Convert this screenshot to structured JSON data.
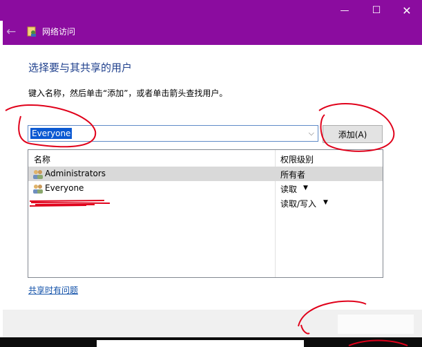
{
  "window": {
    "nav_title": "网络访问",
    "controls": {
      "minimize": "—",
      "maximize": "☐",
      "close": "✕"
    },
    "back_icon": "back-arrow-icon"
  },
  "page": {
    "heading": "选择要与其共享的用户",
    "instruction": "键入名称，然后单击“添加”，或者单击箭头查找用户。"
  },
  "user_input": {
    "value": "Everyone"
  },
  "add_button": {
    "label": "添加(A)"
  },
  "user_table": {
    "headers": [
      "名称",
      "权限级别"
    ],
    "rows": [
      {
        "name": "Administrators",
        "permission": "所有者",
        "selected": true,
        "has_dropdown": false
      },
      {
        "name": "Everyone",
        "permission": "读取",
        "selected": false,
        "has_dropdown": true
      },
      {
        "name": "",
        "permission": "读取/写入",
        "selected": false,
        "has_dropdown": true,
        "redacted": true
      }
    ]
  },
  "help_link": {
    "label": "共享时有问题"
  },
  "colors": {
    "title_bar": "#8b0c9f",
    "heading_text": "#1e3f8c",
    "link": "#0f4fa8",
    "annotation_red": "#e0001a",
    "selection": "#0b59d2"
  }
}
